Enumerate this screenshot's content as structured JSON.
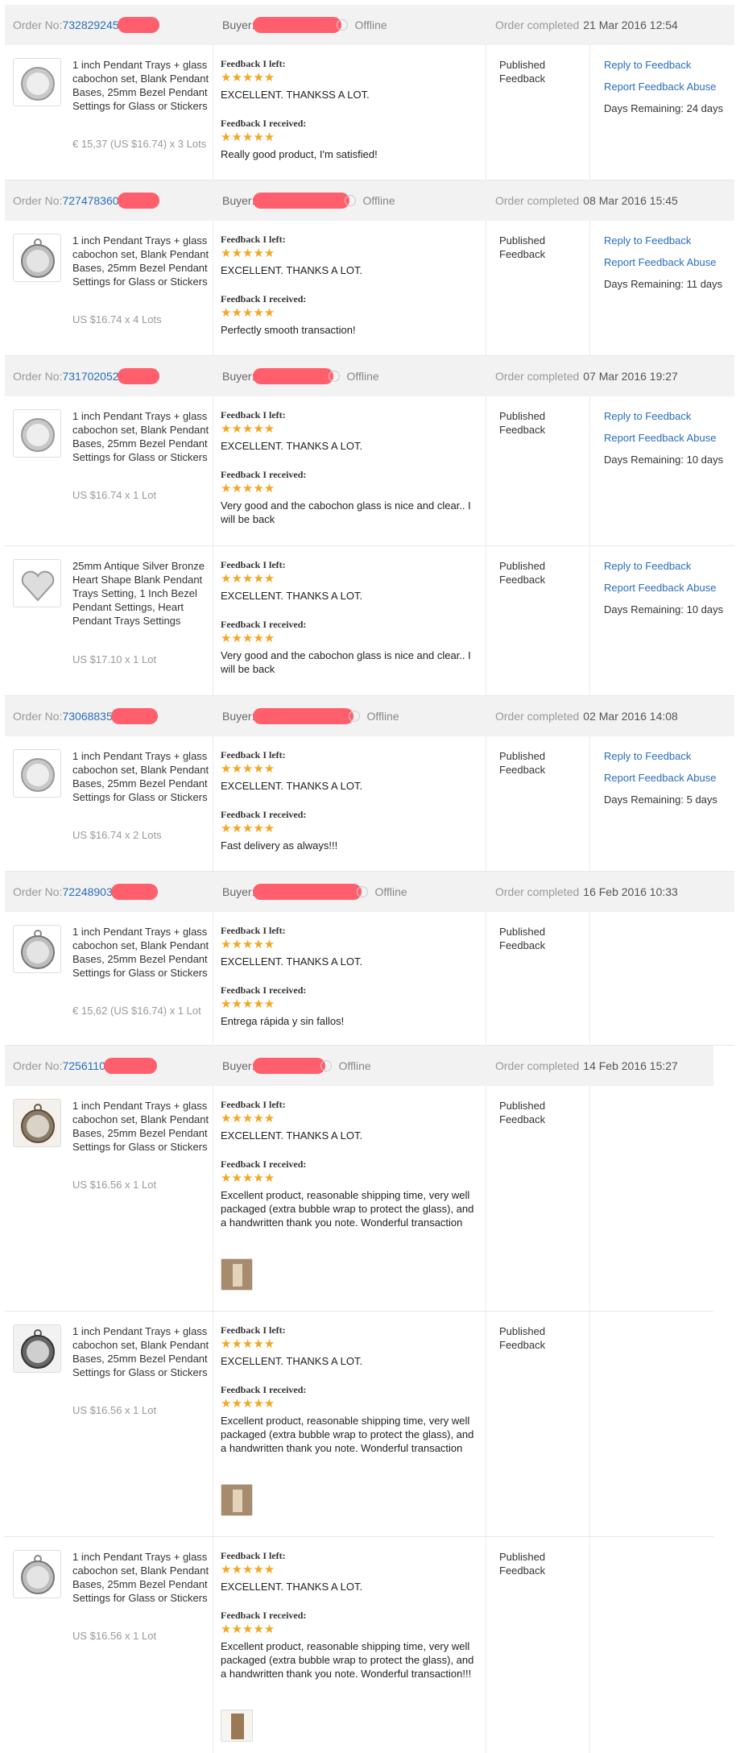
{
  "labels": {
    "order_no": "Order No: ",
    "buyer": "Buyer:",
    "offline": "Offline",
    "order_completed": "Order completed",
    "feedback_left": "Feedback I left:",
    "feedback_received": "Feedback I received:",
    "published": "Published Feedback",
    "reply": "Reply to Feedback",
    "report": "Report Feedback Abuse",
    "stars": "★★★★★"
  },
  "orders": [
    {
      "order_no": "732829245",
      "date": "21 Mar 2016 12:54",
      "items": [
        {
          "title": "1 inch Pendant Trays + glass cabochon set, Blank Pendant Bases, 25mm Bezel Pendant Settings for Glass or Stickers",
          "price": "€ 15,37 (US $16.74) x 3 Lots",
          "feedback_left": "EXCELLENT. THANKSS A LOT.",
          "feedback_received": "Really good product, I'm satisfied!",
          "days_remaining": "Days Remaining: 24 days"
        }
      ]
    },
    {
      "order_no": "727478360",
      "date": "08 Mar 2016 15:45",
      "items": [
        {
          "title": "1 inch Pendant Trays + glass cabochon set, Blank Pendant Bases, 25mm Bezel Pendant Settings for Glass or Stickers",
          "price": "US $16.74 x 4 Lots",
          "feedback_left": "EXCELLENT. THANKS A LOT.",
          "feedback_received": "Perfectly smooth transaction!",
          "days_remaining": "Days Remaining: 11 days"
        }
      ]
    },
    {
      "order_no": "731702052",
      "date": "07 Mar 2016 19:27",
      "items": [
        {
          "title": "1 inch Pendant Trays + glass cabochon set, Blank Pendant Bases, 25mm Bezel Pendant Settings for Glass or Stickers",
          "price": "US $16.74 x 1 Lot",
          "feedback_left": "EXCELLENT. THANKS A LOT.",
          "feedback_received": "Very good and the cabochon glass is nice and clear.. I will be back",
          "days_remaining": "Days Remaining: 10 days"
        },
        {
          "title": "25mm Antique Silver Bronze Heart Shape Blank Pendant Trays Setting, 1 Inch Bezel Pendant Settings, Heart Pendant Trays Settings",
          "price": "US $17.10 x 1 Lot",
          "feedback_left": "EXCELLENT. THANKS A LOT.",
          "feedback_received": "Very good and the cabochon glass is nice and clear.. I will be back",
          "days_remaining": "Days Remaining: 10 days"
        }
      ]
    },
    {
      "order_no": "73068835",
      "date": "02 Mar 2016 14:08",
      "items": [
        {
          "title": "1 inch Pendant Trays + glass cabochon set, Blank Pendant Bases, 25mm Bezel Pendant Settings for Glass or Stickers",
          "price": "US $16.74 x 2 Lots",
          "feedback_left": "EXCELLENT. THANKS A LOT.",
          "feedback_received": "Fast delivery as always!!!",
          "days_remaining": "Days Remaining: 5 days"
        }
      ]
    },
    {
      "order_no": "72248903",
      "date": "16 Feb 2016 10:33",
      "items": [
        {
          "title": "1 inch Pendant Trays + glass cabochon set, Blank Pendant Bases, 25mm Bezel Pendant Settings for Glass or Stickers",
          "price": "€ 15,62 (US $16.74) x 1 Lot",
          "feedback_left": "EXCELLENT. THANKS A LOT.",
          "feedback_received": "Entrega rápida y sin fallos!",
          "days_remaining": ""
        }
      ]
    },
    {
      "order_no": "7256110",
      "date": "14 Feb 2016 15:27",
      "items": [
        {
          "title": "1 inch Pendant Trays + glass cabochon set, Blank Pendant Bases, 25mm Bezel Pendant Settings for Glass or Stickers",
          "price": "US $16.56 x 1 Lot",
          "feedback_left": "EXCELLENT. THANKS A LOT.",
          "feedback_received": "Excellent product, reasonable shipping time, very well packaged (extra bubble wrap to protect the glass), and a handwritten thank you note. Wonderful transaction",
          "days_remaining": ""
        },
        {
          "title": "1 inch Pendant Trays + glass cabochon set, Blank Pendant Bases, 25mm Bezel Pendant Settings for Glass or Stickers",
          "price": "US $16.56 x 1 Lot",
          "feedback_left": "EXCELLENT. THANKS A LOT.",
          "feedback_received": "Excellent product, reasonable shipping time, very well packaged (extra bubble wrap to protect the glass), and a handwritten thank you note. Wonderful transaction",
          "days_remaining": ""
        },
        {
          "title": "1 inch Pendant Trays + glass cabochon set, Blank Pendant Bases, 25mm Bezel Pendant Settings for Glass or Stickers",
          "price": "US $16.56 x 1 Lot",
          "feedback_left": "EXCELLENT. THANKS A LOT.",
          "feedback_received": "Excellent product, reasonable shipping time, very well packaged (extra bubble wrap to protect the glass), and a handwritten thank you note. Wonderful transaction!!!",
          "days_remaining": ""
        }
      ]
    }
  ]
}
